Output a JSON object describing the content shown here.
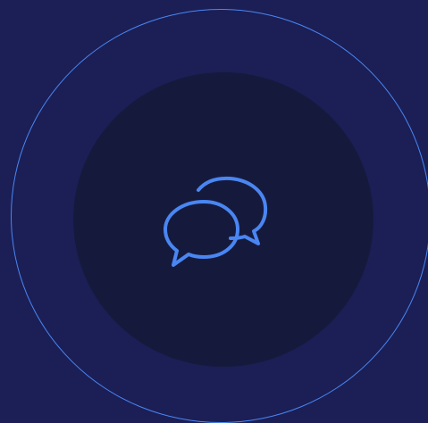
{
  "colors": {
    "background": "#1b1f56",
    "ring": "#4a86f2",
    "disc": "#151a3d",
    "icon": "#4a86f2"
  },
  "icons": {
    "center": "chat-bubbles-icon"
  }
}
